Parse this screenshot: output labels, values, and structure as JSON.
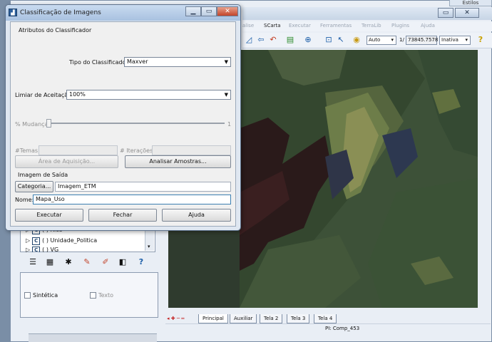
{
  "main_window": {
    "styles_tab": "Estilos",
    "menu": [
      "alise",
      "SCarta",
      "Executar",
      "Ferramentas",
      "TerraLib",
      "Plugins",
      "Ajuda"
    ],
    "toolbar": {
      "scale_mode": "Auto",
      "scale_prefix": "1/",
      "scale_value": "73845.7578",
      "state": "Inativa"
    },
    "map_tabs": [
      "Principal",
      "Auxiliar",
      "Tela 2",
      "Tela 3",
      "Tela 4"
    ],
    "status_text": "PI: Comp_453"
  },
  "layers_panel": {
    "items": [
      {
        "icon": "C",
        "label": "( ) Rios"
      },
      {
        "icon": "C",
        "label": "( ) Unidade_Politica"
      },
      {
        "icon": "C",
        "label": "( ) VG"
      }
    ]
  },
  "view_options": {
    "synthetic_label": "Sintética",
    "text_label": "Texto"
  },
  "dialog": {
    "title": "Classificação de Imagens",
    "group_classifier": "Atributos do Classificador",
    "classifier_type_label": "Tipo do Classificador:",
    "classifier_type_value": "Maxver",
    "acceptance_label": "Limiar de Aceitação:",
    "acceptance_value": "100%",
    "change_label": "% Mudança",
    "change_max": "1",
    "themes_label": "#Temas:",
    "iterations_label": "# Iterações:",
    "acquisition_area_button": "Área de Aquisição...",
    "analyze_samples_button": "Analisar Amostras...",
    "output_group": "Imagem de Saída",
    "category_button": "Categoria...",
    "category_value": "Imagem_ETM",
    "name_label": "Nome:",
    "name_value": "Mapa_Uso",
    "execute_button": "Executar",
    "close_button": "Fechar",
    "help_button": "Ajuda"
  }
}
